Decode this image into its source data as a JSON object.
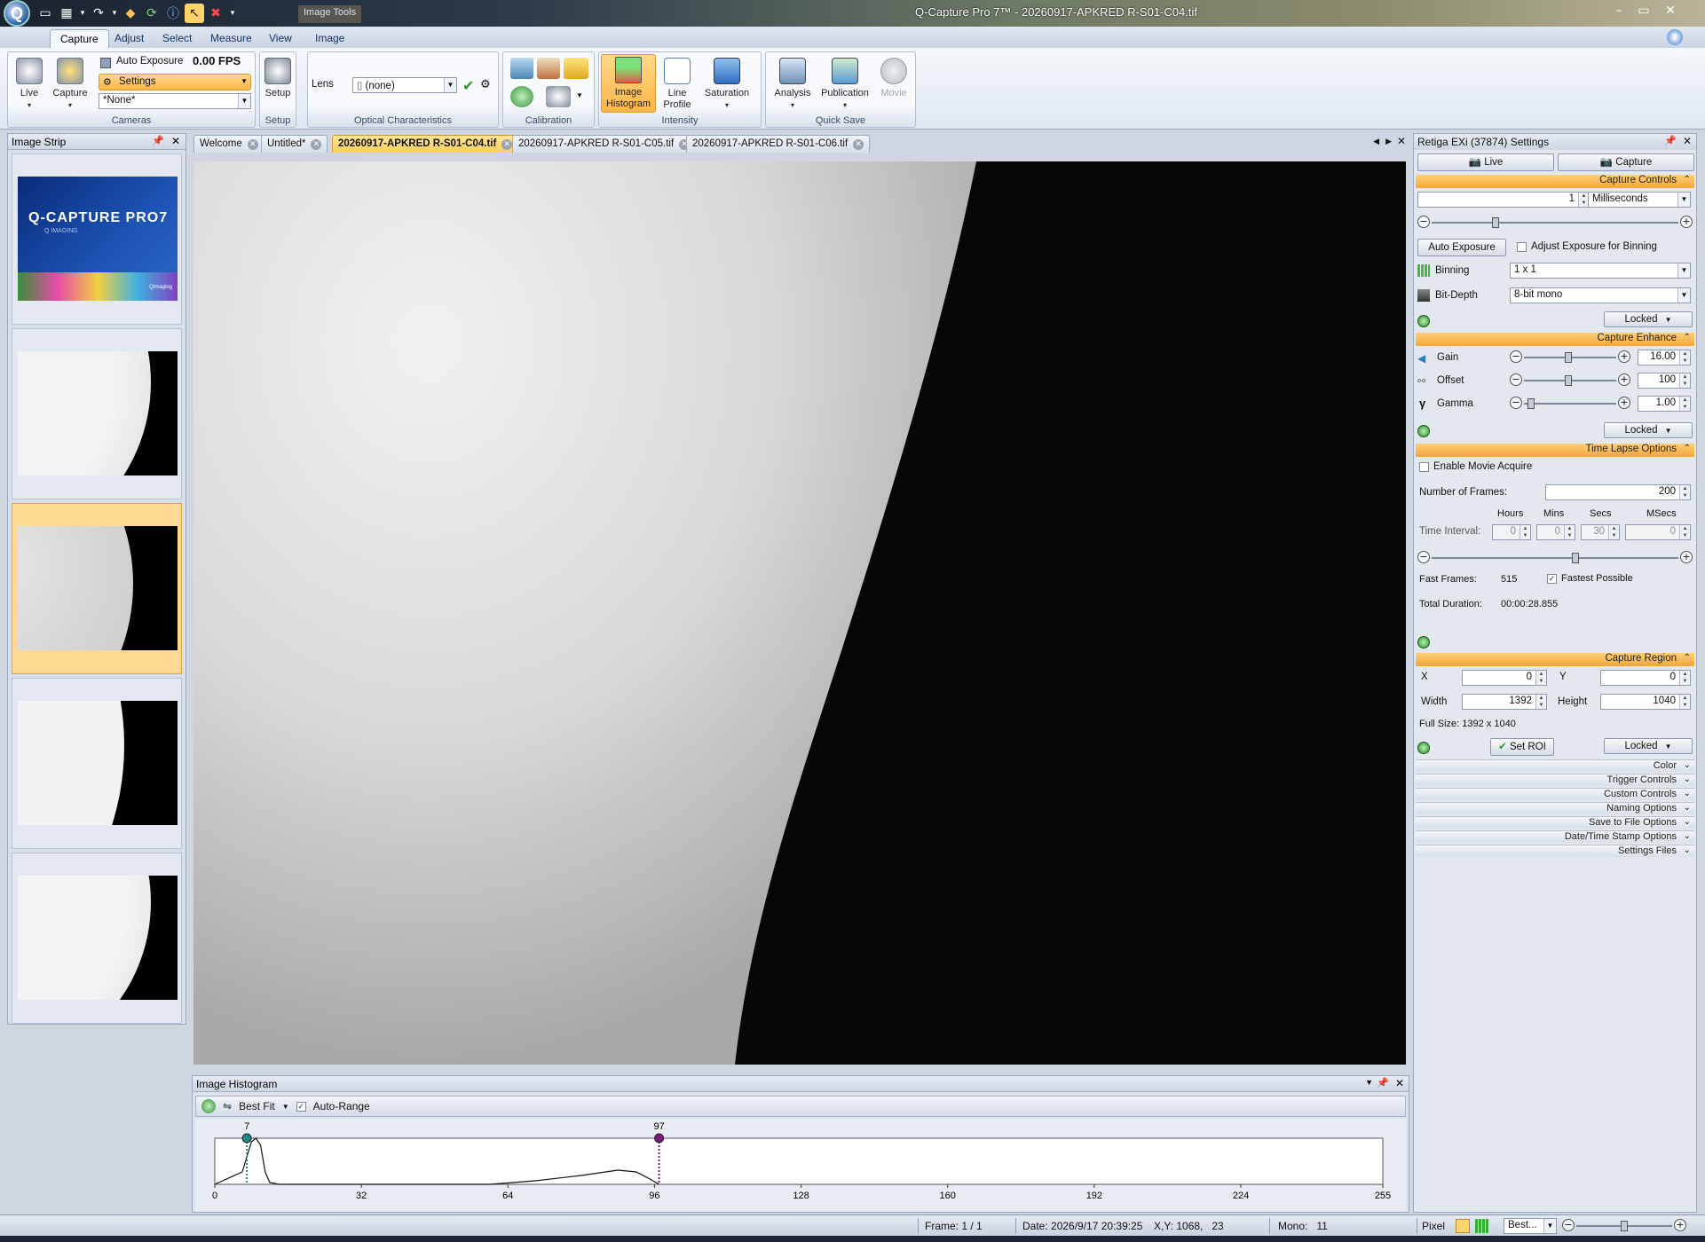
{
  "window": {
    "title": "Q-Capture Pro 7™ - 20260917-APKRED R-S01-C04.tif",
    "context_tab": "Image Tools",
    "app_button": "Q"
  },
  "ribbon_tabs": [
    "Capture",
    "Adjust",
    "Select",
    "Measure",
    "View",
    "Image"
  ],
  "cameras": {
    "live": "Live",
    "capture": "Capture",
    "auto_exposure": "Auto Exposure",
    "fps": "0.00 FPS",
    "settings": "Settings",
    "preset": "*None*",
    "group": "Cameras"
  },
  "setup": {
    "button": "Setup",
    "group": "Setup"
  },
  "optical": {
    "lens_label": "Lens",
    "lens_value": "(none)",
    "group": "Optical Characteristics"
  },
  "calibration": {
    "group": "Calibration"
  },
  "intensity": {
    "histogram": "Image Histogram",
    "line_profile": "Line Profile",
    "saturation": "Saturation",
    "group": "Intensity"
  },
  "quicksave": {
    "analysis": "Analysis",
    "publication": "Publication",
    "movie": "Movie",
    "group": "Quick Save"
  },
  "strip": {
    "title": "Image Strip",
    "splash_title": "Q-CAPTURE PRO7",
    "splash_sub": "Q IMAGING",
    "splash_brand": "QImaging"
  },
  "doc_tabs": [
    "Welcome",
    "Untitled*",
    "20260917-APKRED R-S01-C04.tif",
    "20260917-APKRED R-S01-C05.tif",
    "20260917-APKRED R-S01-C06.tif"
  ],
  "histogram": {
    "title": "Image Histogram",
    "fit": "Best Fit",
    "auto_range": "Auto-Range",
    "marker_low": "7",
    "marker_high": "97",
    "ticks": [
      "0",
      "32",
      "64",
      "96",
      "128",
      "160",
      "192",
      "224",
      "255"
    ],
    "low_color": "#1f8a84",
    "high_color": "#7a1a7a"
  },
  "settings": {
    "title": "Retiga EXi (37874) Settings",
    "tab_live": "Live",
    "tab_capture": "Capture",
    "capture_controls": {
      "header": "Capture Controls",
      "exposure_value": "1",
      "exposure_unit": "Milliseconds",
      "auto_exposure": "Auto Exposure",
      "adjust_binning": "Adjust Exposure for Binning",
      "binning_label": "Binning",
      "binning_value": "1 x 1",
      "bitdepth_label": "Bit-Depth",
      "bitdepth_value": "8-bit mono",
      "locked": "Locked"
    },
    "capture_enhance": {
      "header": "Capture Enhance",
      "gain_label": "Gain",
      "gain_value": "16.00",
      "offset_label": "Offset",
      "offset_value": "100",
      "gamma_label": "Gamma",
      "gamma_value": "1.00",
      "locked": "Locked"
    },
    "time_lapse": {
      "header": "Time Lapse Options",
      "enable_movie": "Enable Movie Acquire",
      "frames_label": "Number of Frames:",
      "frames_value": "200",
      "col_hours": "Hours",
      "col_mins": "Mins",
      "col_secs": "Secs",
      "col_msecs": "MSecs",
      "interval_label": "Time Interval:",
      "hours": "0",
      "mins": "0",
      "secs": "30",
      "msecs": "0",
      "fast_frames_label": "Fast Frames:",
      "fast_frames_value": "515",
      "fastest": "Fastest Possible",
      "duration_label": "Total Duration:",
      "duration_value": "00:00:28.855"
    },
    "capture_region": {
      "header": "Capture Region",
      "x_label": "X",
      "x_value": "0",
      "y_label": "Y",
      "y_value": "0",
      "width_label": "Width",
      "width_value": "1392",
      "height_label": "Height",
      "height_value": "1040",
      "full_size": "Full Size: 1392 x 1040",
      "set_roi": "Set ROI",
      "locked": "Locked"
    },
    "collapsed": [
      "Color",
      "Trigger Controls",
      "Custom Controls",
      "Naming Options",
      "Save to File Options",
      "Date/Time Stamp Options",
      "Settings Files"
    ]
  },
  "status": {
    "frame": "Frame: 1 / 1",
    "date": "Date: 2026/9/17 20:39:25",
    "xy": "X,Y: 1068,   23",
    "mono": "Mono:   11",
    "pixel": "Pixel",
    "zoom": "Best..."
  }
}
